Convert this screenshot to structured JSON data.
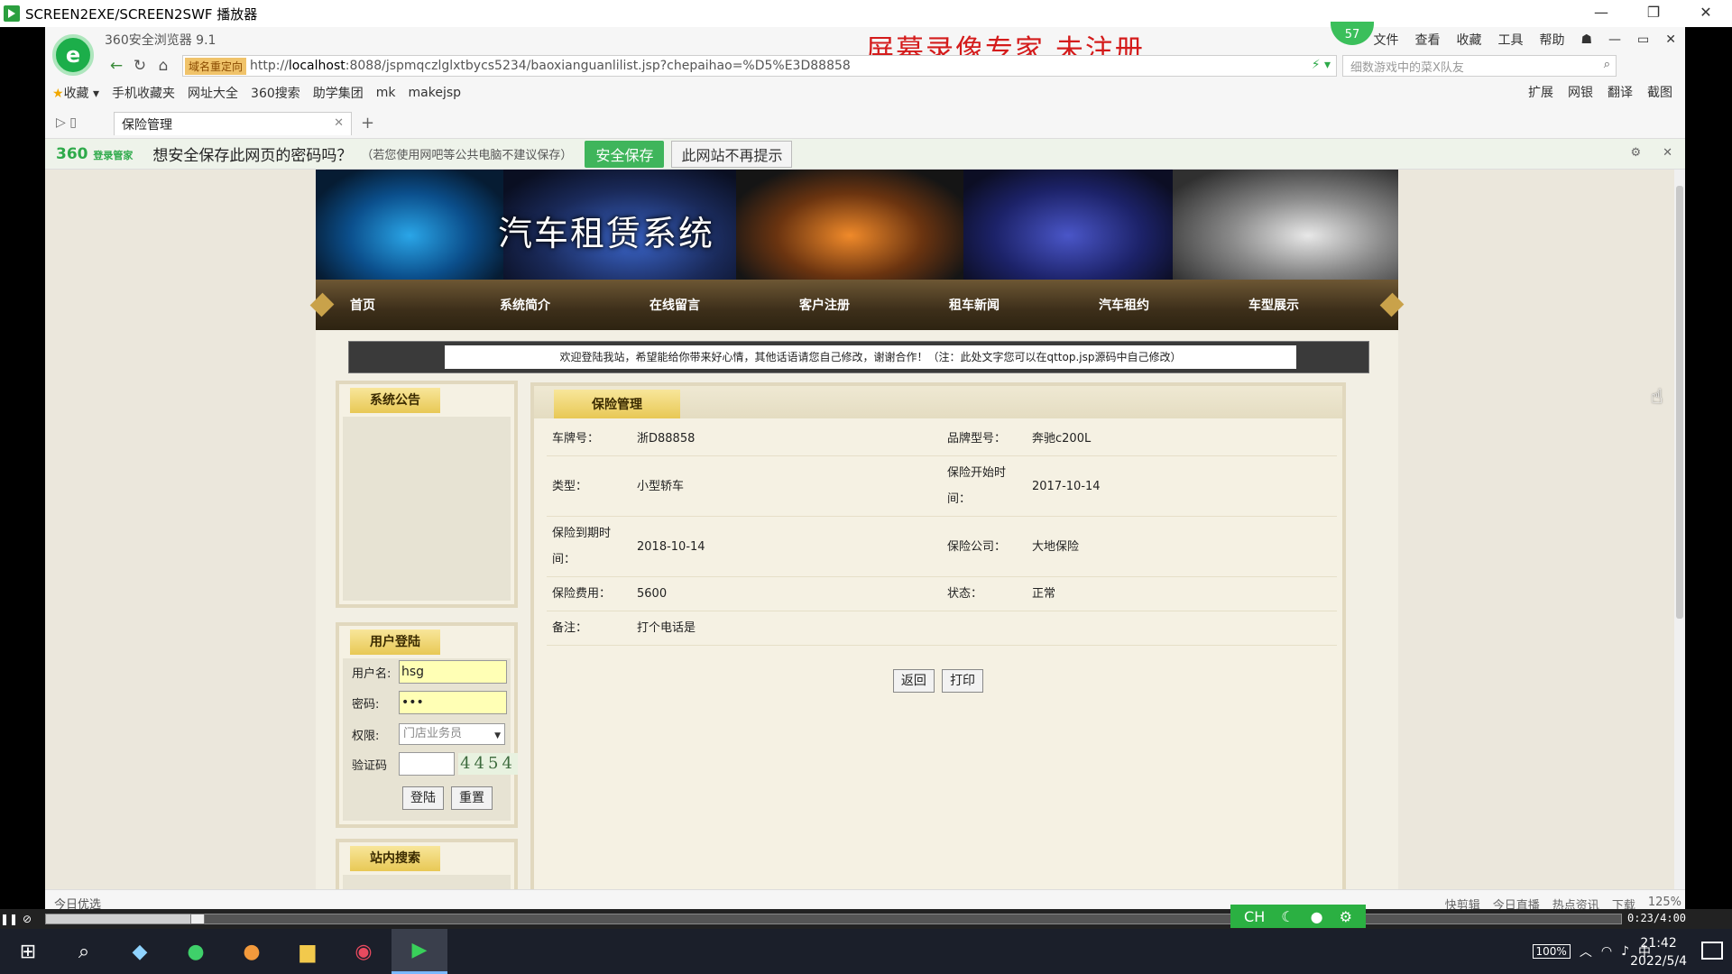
{
  "player": {
    "title": "SCREEN2EXE/SCREEN2SWF 播放器",
    "time": "0:23/4:00",
    "progress_percent": 9.6
  },
  "browser": {
    "version": "360安全浏览器 9.1",
    "watermark": "屏幕录像专家  未注册",
    "badge": "57",
    "menus": [
      "文件",
      "查看",
      "收藏",
      "工具",
      "帮助"
    ],
    "addr_tag": "域名重定向",
    "url_prefix": "http://",
    "url_host": "localhost",
    "url_rest": ":8088/jspmqczlglxtbycs5234/baoxianguanlilist.jsp?chepaihao=%D5%E3D88858",
    "search_placeholder": "细数游戏中的菜X队友",
    "favorites": [
      "收藏",
      "手机收藏夹",
      "网址大全",
      "360搜索",
      "助学集团",
      "mk",
      "makejsp"
    ],
    "tools_right": [
      "扩展",
      "网银",
      "翻译",
      "截图"
    ],
    "tab_title": "保险管理",
    "pw_logo": "360",
    "pw_logo_sub": "登录管家",
    "pw_question": "想安全保存此网页的密码吗？",
    "pw_hint": "（若您使用网吧等公共电脑不建议保存）",
    "pw_save": "安全保存",
    "pw_no": "此网站不再提示",
    "status_left": "今日优选",
    "status_right": [
      "快剪辑",
      "今日直播",
      "热点资讯",
      "下载",
      "125%"
    ]
  },
  "site": {
    "banner_title": "汽车租赁系统",
    "nav": [
      "首页",
      "系统简介",
      "在线留言",
      "客户注册",
      "租车新闻",
      "汽车租约",
      "车型展示"
    ],
    "notice": "欢迎登陆我站，希望能给你带来好心情，其他话语请您自己修改，谢谢合作！（注：此处文字您可以在qttop.jsp源码中自己修改）",
    "announce_title": "系统公告",
    "login_title": "用户登陆",
    "login": {
      "username_label": "用户名:",
      "username_value": "hsg",
      "password_label": "密码:",
      "password_value": "•••",
      "role_label": "权限:",
      "role_value": "门店业务员",
      "captcha_label": "验证码",
      "captcha_value": "4454",
      "login_btn": "登陆",
      "reset_btn": "重置"
    },
    "search_title": "站内搜索"
  },
  "insurance": {
    "title": "保险管理",
    "rows": [
      {
        "l1": "车牌号：",
        "v1": "浙D88858",
        "l2": "品牌型号：",
        "v2": "奔驰c200L"
      },
      {
        "l1": "类型：",
        "v1": "小型轿车",
        "l2": "保险开始时间：",
        "v2": "2017-10-14"
      },
      {
        "l1": "保险到期时间：",
        "v1": "2018-10-14",
        "l2": "保险公司：",
        "v2": "大地保险"
      },
      {
        "l1": "保险费用：",
        "v1": "5600",
        "l2": "状态：",
        "v2": "正常"
      },
      {
        "l1": "备注：",
        "v1": "打个电话是",
        "l2": "",
        "v2": ""
      }
    ],
    "back_btn": "返回",
    "print_btn": "打印"
  },
  "ime": {
    "label": "CH"
  },
  "taskbar": {
    "battery": "100%",
    "lang": "中",
    "time": "21:42",
    "date": "2022/5/4"
  }
}
